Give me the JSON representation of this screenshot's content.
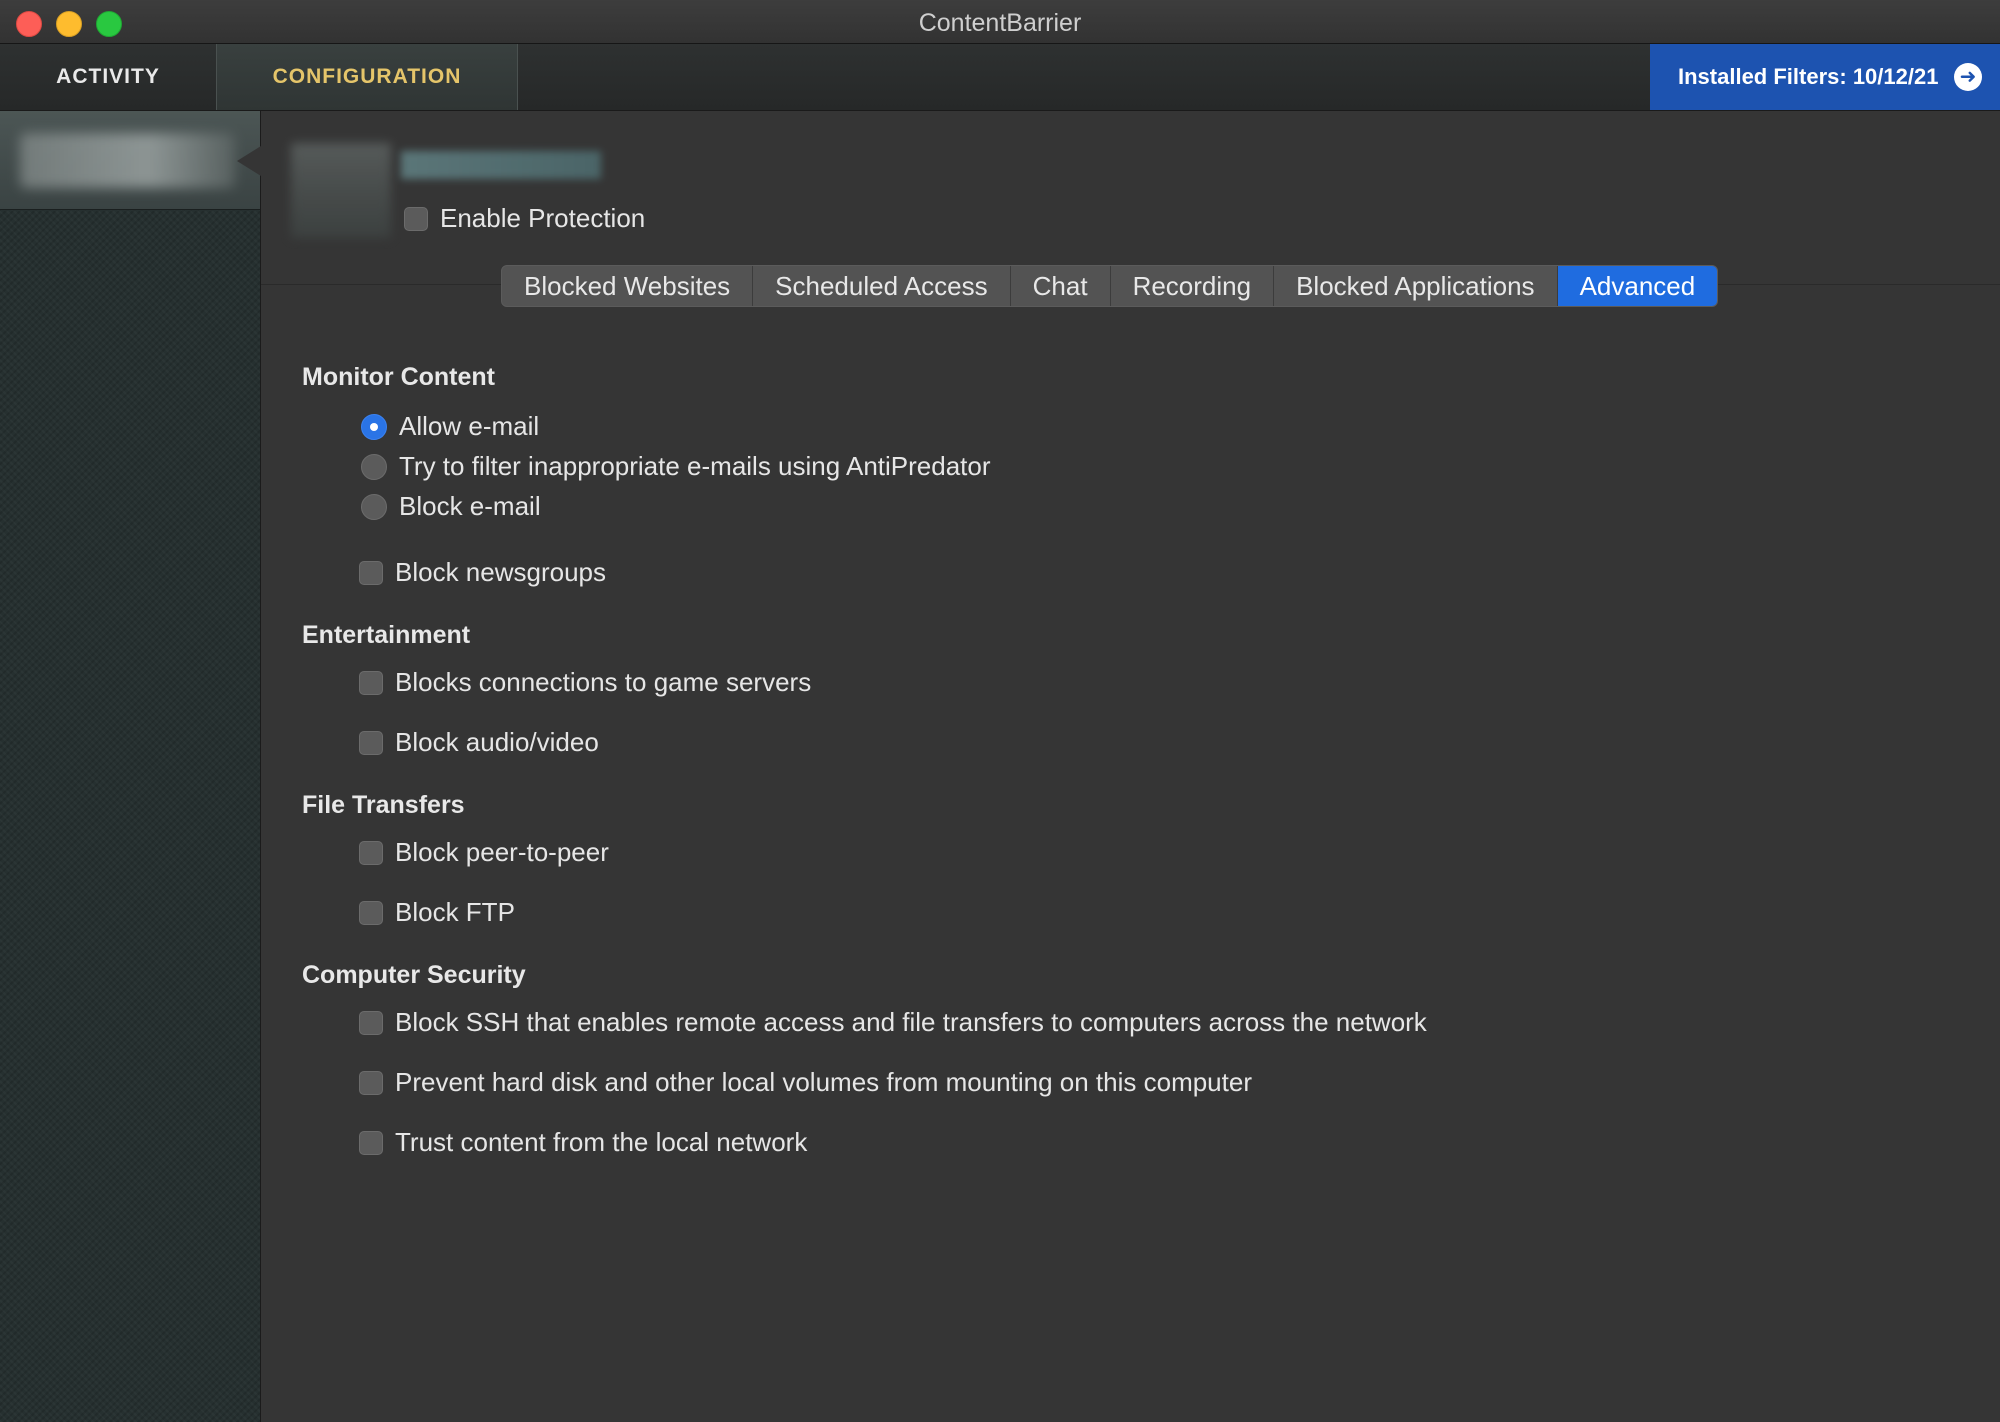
{
  "window": {
    "title": "ContentBarrier"
  },
  "topnav": {
    "activity_label": "ACTIVITY",
    "configuration_label": "CONFIGURATION",
    "filters_label": "Installed Filters: 10/12/21"
  },
  "main": {
    "enable_protection_label": "Enable Protection",
    "tabs": [
      {
        "label": "Blocked Websites"
      },
      {
        "label": "Scheduled Access"
      },
      {
        "label": "Chat"
      },
      {
        "label": "Recording"
      },
      {
        "label": "Blocked Applications"
      },
      {
        "label": "Advanced"
      }
    ],
    "active_tab": "Advanced",
    "monitor_content": {
      "title": "Monitor Content",
      "radios": [
        {
          "label": "Allow e-mail",
          "selected": true
        },
        {
          "label": "Try to filter inappropriate e-mails using AntiPredator",
          "selected": false
        },
        {
          "label": "Block e-mail",
          "selected": false
        }
      ],
      "block_newsgroups_label": "Block newsgroups"
    },
    "entertainment": {
      "title": "Entertainment",
      "game_servers_label": "Blocks connections to game servers",
      "audio_video_label": "Block audio/video"
    },
    "file_transfers": {
      "title": "File Transfers",
      "p2p_label": "Block peer-to-peer",
      "ftp_label": "Block FTP"
    },
    "computer_security": {
      "title": "Computer Security",
      "ssh_label": "Block SSH that enables remote access and file transfers to computers across the network",
      "mount_label": "Prevent hard disk and other local volumes from mounting on this computer",
      "trust_label": "Trust content from the local network"
    }
  },
  "colors": {
    "accent": "#1f6ce0",
    "config_tab_text": "#e5c56a",
    "background": "#353535"
  }
}
